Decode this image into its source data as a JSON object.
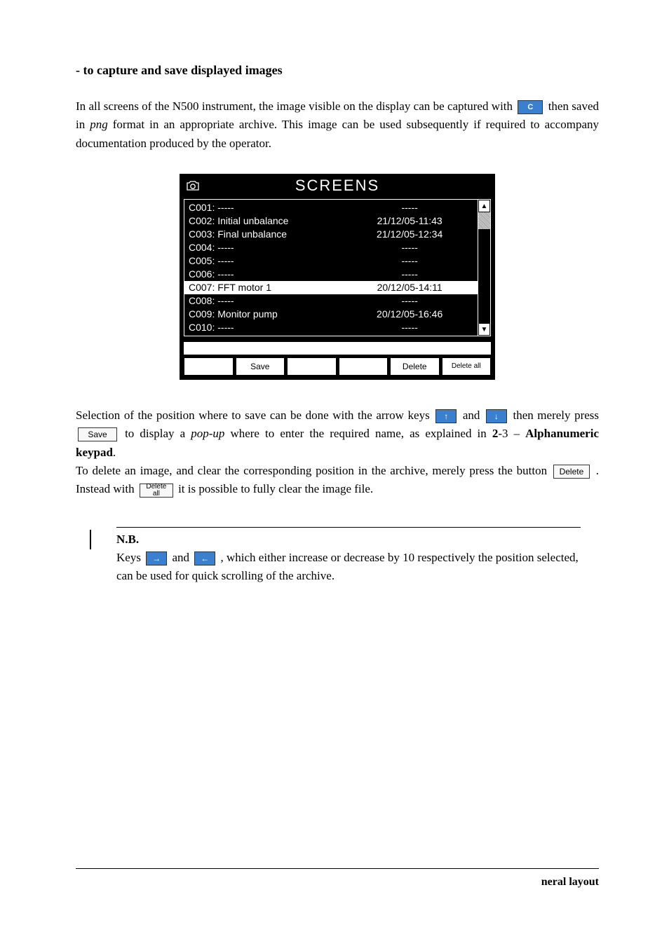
{
  "heading": "- to capture and save displayed images",
  "para1_a": "In all screens of the N500 instrument,   the image visible on the display can be captured with ",
  "c_key_label": "C",
  "para1_b": " then saved in ",
  "png_word": "png",
  "para1_c": " format in an appropriate archive. This image can be used subsequently if required to accompany documentation produced by the operator.",
  "device": {
    "title": "SCREENS",
    "rows": [
      {
        "left": "C001: -----",
        "right": "-----",
        "selected": false
      },
      {
        "left": "C002: Initial unbalance",
        "right": "21/12/05-11:43",
        "selected": false
      },
      {
        "left": "C003: Final unbalance",
        "right": "21/12/05-12:34",
        "selected": false
      },
      {
        "left": "C004: -----",
        "right": "-----",
        "selected": false
      },
      {
        "left": "C005: -----",
        "right": "-----",
        "selected": false
      },
      {
        "left": "C006: -----",
        "right": "-----",
        "selected": false
      },
      {
        "left": "C007: FFT motor 1",
        "right": "20/12/05-14:11",
        "selected": true
      },
      {
        "left": "C008: -----",
        "right": "-----",
        "selected": false
      },
      {
        "left": "C009: Monitor pump",
        "right": "20/12/05-16:46",
        "selected": false
      },
      {
        "left": "C010: -----",
        "right": "-----",
        "selected": false
      }
    ],
    "buttons": {
      "save": "Save",
      "delete": "Delete",
      "delete_all": "Delete all"
    }
  },
  "para2_a": "Selection of the position where to save can be done with the arrow keys ",
  "para2_and": " and ",
  "para2_b": " then merely press ",
  "save_key_label": "Save",
  "para2_c": " to display a ",
  "popup_word": "pop-up",
  "para2_d": " where to enter the required name, as explained in ",
  "ref_bold": "2",
  "ref_mid": "-3 – ",
  "ref_bold2": "Alphanumeric keypad",
  "ref_end": ".",
  "para3_a": "To delete an image, and clear the corresponding position in the archive,  merely press the button ",
  "delete_key_label": "Delete",
  "para3_b": " . Instead with ",
  "deleteall_key_label": "Delete all",
  "para3_c": " it is possible to fully clear the image file.",
  "nb": {
    "title": "N.B.",
    "line1_a": "Keys ",
    "line1_b": " and ",
    "line1_c": " , which either increase or decrease by 10 respectively the position selected, can be used for quick scrolling of the archive."
  },
  "footer": "neral layout"
}
